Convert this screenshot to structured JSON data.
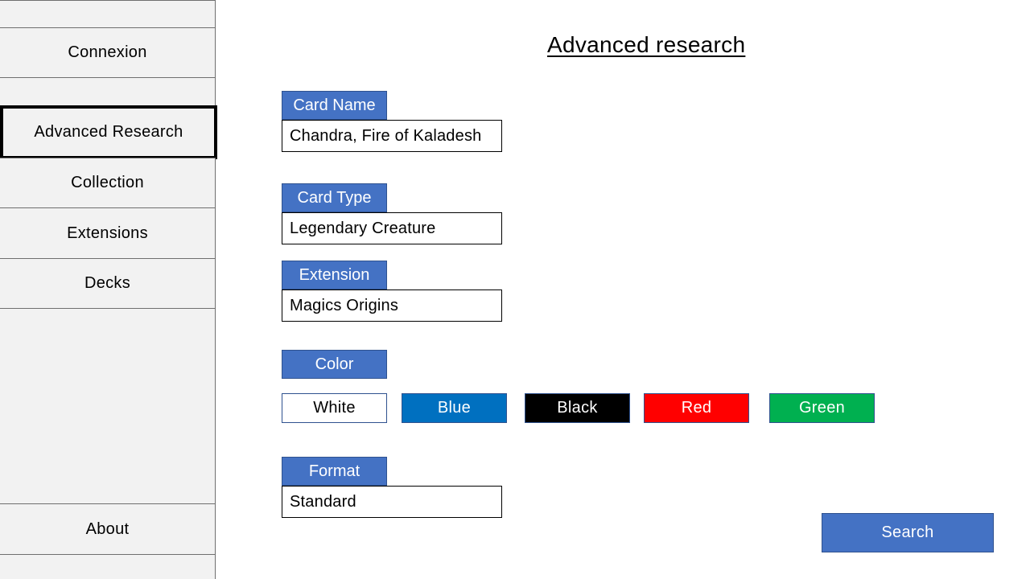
{
  "sidebar": {
    "items": [
      {
        "label": ""
      },
      {
        "label": "Connexion"
      },
      {
        "label": ""
      },
      {
        "label": "Advanced Research"
      },
      {
        "label": "Collection"
      },
      {
        "label": "Extensions"
      },
      {
        "label": "Decks"
      },
      {
        "label": ""
      },
      {
        "label": "About"
      },
      {
        "label": ""
      }
    ],
    "active": "Advanced Research"
  },
  "main": {
    "title": "Advanced research",
    "card_name": {
      "label": "Card Name",
      "value": "Chandra, Fire of Kaladesh"
    },
    "card_type": {
      "label": "Card Type",
      "value": "Legendary Creature"
    },
    "extension": {
      "label": "Extension",
      "value": "Magics Origins"
    },
    "color": {
      "label": "Color",
      "options": [
        {
          "label": "White",
          "bg": "#ffffff",
          "fg": "#000000",
          "border": "#2f528f"
        },
        {
          "label": "Blue",
          "bg": "#0070c0",
          "fg": "#ffffff",
          "border": "#2f528f"
        },
        {
          "label": "Black",
          "bg": "#000000",
          "fg": "#ffffff",
          "border": "#2f528f"
        },
        {
          "label": "Red",
          "bg": "#ff0000",
          "fg": "#ffffff",
          "border": "#2f528f"
        },
        {
          "label": "Green",
          "bg": "#00b050",
          "fg": "#ffffff",
          "border": "#2f528f"
        }
      ]
    },
    "format": {
      "label": "Format",
      "value": "Standard"
    },
    "search_label": "Search"
  },
  "colors": {
    "accent": "#4472c4",
    "accent_border": "#2f528f",
    "sidebar_bg": "#f2f2f2"
  }
}
